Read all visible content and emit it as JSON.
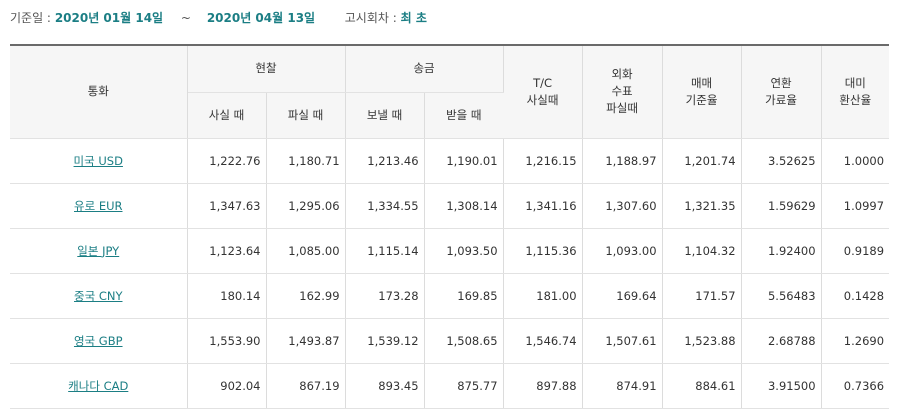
{
  "info": {
    "base_date_label": "기준일 :",
    "start_date": "2020년 01월 14일",
    "separator": "~",
    "end_date": "2020년 04월 13일",
    "notice_label": "고시회차 :",
    "notice_value": "최 초"
  },
  "header": {
    "currency": "통화",
    "cash": "현찰",
    "cash_buy": "사실 때",
    "cash_sell": "파실 때",
    "remit": "송금",
    "remit_send": "보낼 때",
    "remit_receive": "받을 때",
    "tc_lines": [
      "T/C",
      "사실때"
    ],
    "check_lines": [
      "외화",
      "수표",
      "파실때"
    ],
    "base_lines": [
      "매매",
      "기준율"
    ],
    "conv_lines": [
      "연환",
      "가료율"
    ],
    "usd_lines": [
      "대미",
      "환산율"
    ]
  },
  "rows": [
    {
      "currency": "미국 USD",
      "cash_buy": "1,222.76",
      "cash_sell": "1,180.71",
      "send": "1,213.46",
      "receive": "1,190.01",
      "tc": "1,216.15",
      "check": "1,188.97",
      "base": "1,201.74",
      "conv": "3.52625",
      "usd": "1.0000"
    },
    {
      "currency": "유로 EUR",
      "cash_buy": "1,347.63",
      "cash_sell": "1,295.06",
      "send": "1,334.55",
      "receive": "1,308.14",
      "tc": "1,341.16",
      "check": "1,307.60",
      "base": "1,321.35",
      "conv": "1.59629",
      "usd": "1.0997"
    },
    {
      "currency": "일본 JPY",
      "cash_buy": "1,123.64",
      "cash_sell": "1,085.00",
      "send": "1,115.14",
      "receive": "1,093.50",
      "tc": "1,115.36",
      "check": "1,093.00",
      "base": "1,104.32",
      "conv": "1.92400",
      "usd": "0.9189"
    },
    {
      "currency": "중국 CNY",
      "cash_buy": "180.14",
      "cash_sell": "162.99",
      "send": "173.28",
      "receive": "169.85",
      "tc": "181.00",
      "check": "169.64",
      "base": "171.57",
      "conv": "5.56483",
      "usd": "0.1428"
    },
    {
      "currency": "영국 GBP",
      "cash_buy": "1,553.90",
      "cash_sell": "1,493.87",
      "send": "1,539.12",
      "receive": "1,508.65",
      "tc": "1,546.74",
      "check": "1,507.61",
      "base": "1,523.88",
      "conv": "2.68788",
      "usd": "1.2690"
    },
    {
      "currency": "캐나다 CAD",
      "cash_buy": "902.04",
      "cash_sell": "867.19",
      "send": "893.45",
      "receive": "875.77",
      "tc": "897.88",
      "check": "874.91",
      "base": "884.61",
      "conv": "3.91500",
      "usd": "0.7366"
    }
  ],
  "colors": {
    "accent": "#1b7e84",
    "header_bg": "#f6f6f6",
    "border": "#dcdcdc",
    "top_border": "#6a6a6a"
  }
}
